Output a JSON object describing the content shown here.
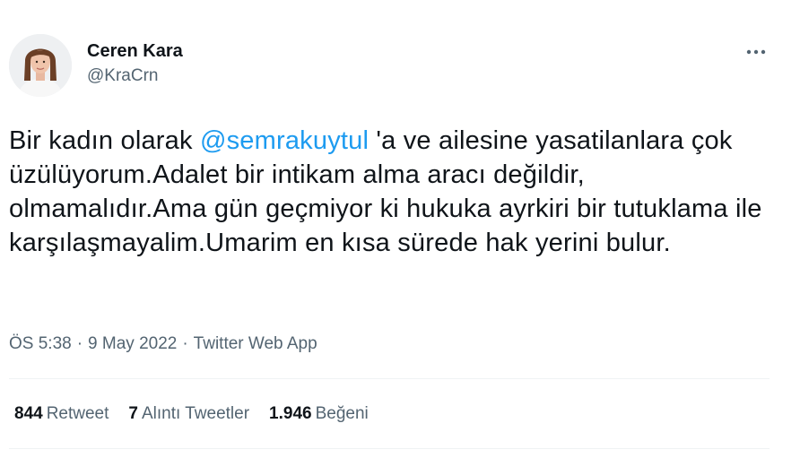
{
  "author": {
    "display_name": "Ceren Kara",
    "handle": "@KraCrn"
  },
  "tweet": {
    "text_before": "Bir kadın olarak ",
    "mention": "@semrakuytul",
    "text_after": " 'a ve ailesine yasatilanlara çok üzülüyorum.Adalet bir intikam alma aracı değildir, olmamalıdır.Ama gün geçmiyor ki hukuka ayrkiri bir tutuklama ile karşılaşmayalim.Umarim en kısa sürede hak yerini bulur."
  },
  "meta": {
    "time": "ÖS 5:38",
    "separator": "·",
    "date": "9 May 2022",
    "source": "Twitter Web App"
  },
  "stats": {
    "retweets_count": "844",
    "retweets_label": "Retweet",
    "quotes_count": "7",
    "quotes_label": "Alıntı Tweetler",
    "likes_count": "1.946",
    "likes_label": "Beğeni"
  },
  "icons": {
    "more": "more-horizontal-icon",
    "avatar": "profile-photo"
  },
  "colors": {
    "link": "#1d9bf0",
    "text": "#0f1419",
    "secondary": "#536471",
    "divider": "#eff3f4"
  }
}
